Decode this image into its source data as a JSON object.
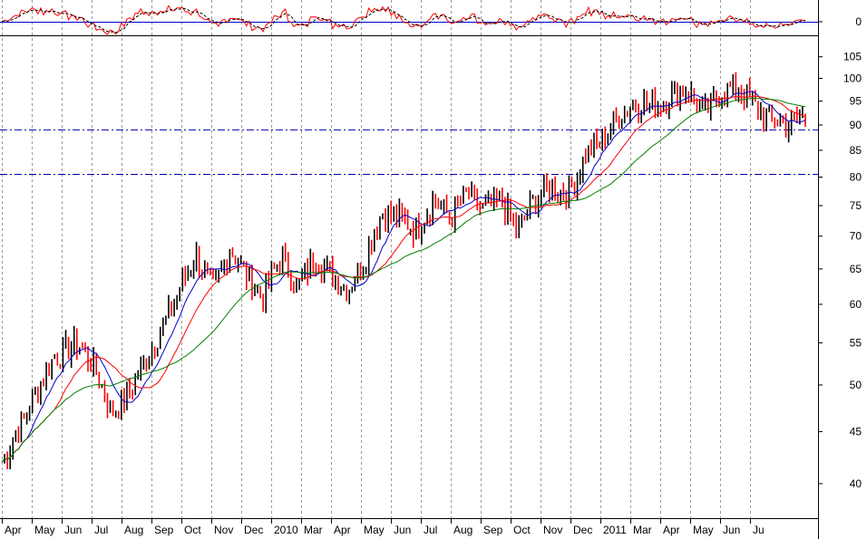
{
  "chart_data": {
    "type": "candlestick",
    "title": "",
    "xlabel": "",
    "ylabel": "",
    "y_scale": "log",
    "ylim": [
      37,
      110
    ],
    "y_ticks": [
      40,
      45,
      50,
      55,
      60,
      65,
      70,
      75,
      80,
      85,
      90,
      95,
      100,
      105
    ],
    "x_tick_labels": [
      "Apr",
      "May",
      "Jun",
      "Jul",
      "Aug",
      "Sep",
      "Oct",
      "Nov",
      "Dec",
      "2010",
      "Mar",
      "Apr",
      "May",
      "Jun",
      "Jul",
      "Aug",
      "Sep",
      "Oct",
      "Nov",
      "Dec",
      "2011",
      "Mar",
      "Apr",
      "May",
      "Jun",
      "Ju"
    ],
    "grid": "vertical dashed",
    "horizontal_lines": [
      89,
      80.5
    ],
    "colors": {
      "up_bar": "#000000",
      "down_bar": "#ff0000",
      "short_ma": "#0000cc",
      "medium_ma": "#ff0000",
      "long_ma": "#008000",
      "reference_line": "#0000aa"
    },
    "price_path": [
      [
        0,
        42
      ],
      [
        3,
        47
      ],
      [
        6,
        53
      ],
      [
        9,
        55
      ],
      [
        11,
        52
      ],
      [
        13,
        47
      ],
      [
        15,
        49
      ],
      [
        17,
        53
      ],
      [
        19,
        57
      ],
      [
        21,
        62
      ],
      [
        23,
        67
      ],
      [
        25,
        62
      ],
      [
        27,
        68
      ],
      [
        29,
        64
      ],
      [
        31,
        61
      ],
      [
        33,
        67
      ],
      [
        35,
        62
      ],
      [
        37,
        67
      ],
      [
        39,
        64
      ],
      [
        41,
        62
      ],
      [
        43,
        67
      ],
      [
        45,
        74
      ],
      [
        47,
        73
      ],
      [
        49,
        71
      ],
      [
        51,
        76
      ],
      [
        53,
        73
      ],
      [
        55,
        77
      ],
      [
        57,
        74
      ],
      [
        59,
        76
      ],
      [
        61,
        71
      ],
      [
        63,
        76
      ],
      [
        65,
        78
      ],
      [
        67,
        77
      ],
      [
        69,
        84
      ],
      [
        71,
        87
      ],
      [
        73,
        92
      ],
      [
        75,
        95
      ],
      [
        77,
        94
      ],
      [
        79,
        96
      ],
      [
        81,
        98
      ],
      [
        83,
        92
      ],
      [
        85,
        97
      ],
      [
        87,
        98
      ],
      [
        89,
        94
      ],
      [
        91,
        91
      ],
      [
        93,
        90
      ],
      [
        95,
        92
      ]
    ],
    "oscillator": {
      "y_ticks": [
        0
      ]
    }
  }
}
